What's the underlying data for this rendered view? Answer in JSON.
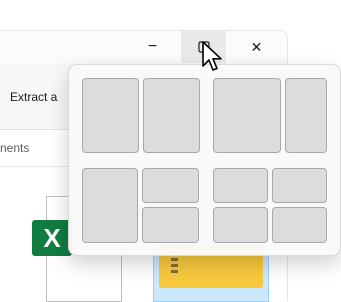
{
  "window": {
    "controls": {
      "minimize": "−",
      "close": "✕"
    },
    "ribbon": {
      "extract_label": "Extract a"
    },
    "address_bar": {
      "text": "nents"
    }
  },
  "content": {
    "excel_badge": "X"
  },
  "snap_layouts": {
    "layouts": [
      {
        "name": "two-columns-equal",
        "zones": 2
      },
      {
        "name": "two-columns-wide-left",
        "zones": 2
      },
      {
        "name": "left-column-right-stacked",
        "zones": 3
      },
      {
        "name": "four-quadrants",
        "zones": 4
      }
    ]
  },
  "icons": [
    "minimize-icon",
    "maximize-icon",
    "close-icon",
    "mouse-cursor-icon",
    "excel-icon",
    "zip-folder-icon"
  ],
  "colors": {
    "excel_green": "#107c41",
    "folder_yellow": "#f8c93c",
    "selection_blue": "#cce8ff"
  }
}
